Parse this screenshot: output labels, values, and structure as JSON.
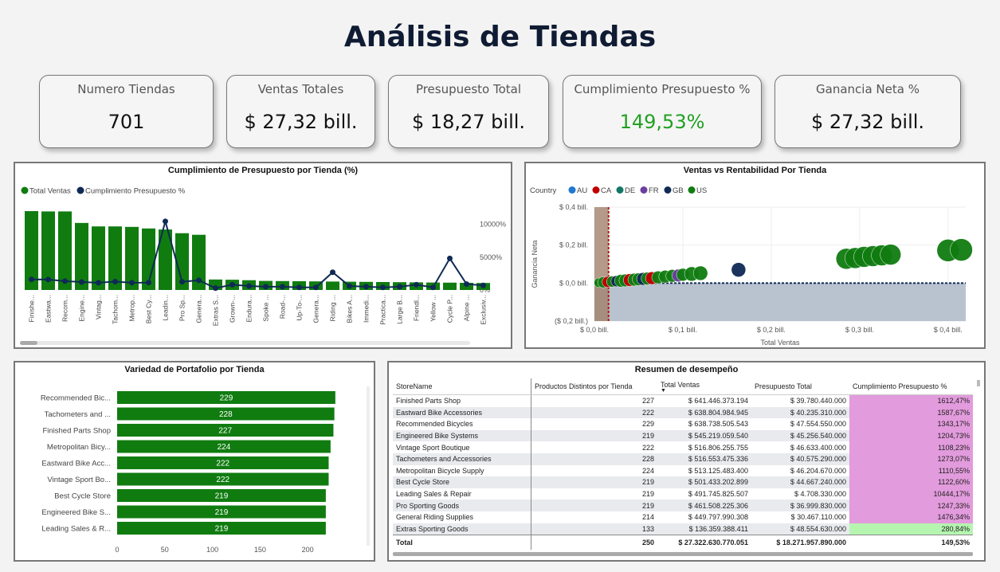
{
  "page": {
    "title": "Análisis de Tiendas"
  },
  "kpis": [
    {
      "label": "Numero Tiendas",
      "value": "701",
      "color": "#111111"
    },
    {
      "label": "Ventas Totales",
      "value": "$ 27,32 bill.",
      "color": "#111111"
    },
    {
      "label": "Presupuesto Total",
      "value": "$ 18,27 bill.",
      "color": "#111111"
    },
    {
      "label": "Cumplimiento Presupuesto %",
      "value": "149,53%",
      "color": "#22a022"
    },
    {
      "label": "Ganancia Neta %",
      "value": "$ 27,32 bill.",
      "color": "#111111"
    }
  ],
  "panels": {
    "combo": "Cumplimiento de Presupuesto por Tienda (%)",
    "scatter": "Ventas vs Rentabilidad Por Tienda",
    "hbar": "Variedad de Portafolio por Tienda",
    "table": "Resumen de desempeño"
  },
  "chart_data": [
    {
      "type": "bar",
      "title": "Cumplimiento de Presupuesto por Tienda (%)",
      "legend": [
        "Total Ventas",
        "Cumplimiento Presupuesto %"
      ],
      "legend_position": "top-left",
      "colors": {
        "bars": "#107c10",
        "line": "#0f2a55"
      },
      "categories": [
        "Finishe...",
        "Eastwa...",
        "Recom...",
        "Engine...",
        "Vintag...",
        "Tachom...",
        "Metrop...",
        "Best Cy...",
        "Leadin...",
        "Pro Sp...",
        "Genera...",
        "Extras S...",
        "Grown-...",
        "Endura...",
        "Spoke ...",
        "Road-...",
        "Up-To-...",
        "Genera...",
        "Riding ...",
        "Bikes A...",
        "Immedi...",
        "Practica...",
        "Large B...",
        "Friendl...",
        "Yellow ...",
        "Cycle P...",
        "Alpine ...",
        "Exclusiv..."
      ],
      "series": [
        {
          "name": "Total Ventas",
          "values": [
            100,
            99.6,
            99.6,
            85,
            80.6,
            80.6,
            80,
            78,
            76.7,
            72,
            70,
            13.3,
            13,
            12.4,
            11.5,
            11.3,
            11.1,
            10.9,
            10.7,
            10.5,
            10.3,
            10.1,
            9.9,
            9.7,
            9.5,
            9.3,
            9.1,
            8.9
          ]
        },
        {
          "name": "Cumplimiento Presupuesto %",
          "values": [
            1612,
            1588,
            1343,
            1205,
            1108,
            1273,
            1111,
            1123,
            10444,
            1247,
            1476,
            281,
            800,
            600,
            500,
            500,
            400,
            400,
            2700,
            600,
            500,
            400,
            500,
            800,
            400,
            4800,
            900,
            700
          ]
        }
      ],
      "y2_ticks": [
        "10000%",
        "5000%",
        "0%"
      ],
      "y2lim": [
        0,
        12000
      ]
    },
    {
      "type": "scatter",
      "title": "Ventas vs Rentabilidad Por Tienda",
      "legend_title": "Country",
      "legend": [
        {
          "name": "AU",
          "color": "#1f78d1"
        },
        {
          "name": "CA",
          "color": "#c00000"
        },
        {
          "name": "DE",
          "color": "#117865"
        },
        {
          "name": "FR",
          "color": "#6b3fa0"
        },
        {
          "name": "GB",
          "color": "#0f2a55"
        },
        {
          "name": "US",
          "color": "#107c10"
        }
      ],
      "legend_position": "top-left",
      "xlabel": "Total Ventas",
      "ylabel": "Ganancia Neta",
      "x_ticks": [
        "$ 0,0 bill.",
        "$ 0,1 bill.",
        "$ 0,2 bill.",
        "$ 0,3 bill.",
        "$ 0,4 bill."
      ],
      "y_ticks": [
        "$ 0,4 bill.",
        "$ 0,2 bill.",
        "$ 0,0 bill.",
        "($ 0,2 bill.)"
      ],
      "xlim": [
        0,
        0.42
      ],
      "ylim": [
        -0.2,
        0.4
      ],
      "points": [
        {
          "x": 0.005,
          "y": 0.002,
          "c": "US",
          "r": 6
        },
        {
          "x": 0.01,
          "y": 0.004,
          "c": "US",
          "r": 7
        },
        {
          "x": 0.015,
          "y": 0.006,
          "c": "CA",
          "r": 7
        },
        {
          "x": 0.02,
          "y": 0.008,
          "c": "US",
          "r": 7
        },
        {
          "x": 0.025,
          "y": 0.01,
          "c": "GB",
          "r": 7
        },
        {
          "x": 0.03,
          "y": 0.012,
          "c": "US",
          "r": 8
        },
        {
          "x": 0.035,
          "y": 0.014,
          "c": "US",
          "r": 8
        },
        {
          "x": 0.04,
          "y": 0.016,
          "c": "CA",
          "r": 8
        },
        {
          "x": 0.045,
          "y": 0.018,
          "c": "US",
          "r": 8
        },
        {
          "x": 0.05,
          "y": 0.02,
          "c": "US",
          "r": 8
        },
        {
          "x": 0.055,
          "y": 0.022,
          "c": "GB",
          "r": 8
        },
        {
          "x": 0.06,
          "y": 0.024,
          "c": "US",
          "r": 8
        },
        {
          "x": 0.065,
          "y": 0.026,
          "c": "CA",
          "r": 8
        },
        {
          "x": 0.072,
          "y": 0.03,
          "c": "US",
          "r": 8
        },
        {
          "x": 0.08,
          "y": 0.034,
          "c": "US",
          "r": 8
        },
        {
          "x": 0.088,
          "y": 0.038,
          "c": "US",
          "r": 8
        },
        {
          "x": 0.095,
          "y": 0.04,
          "c": "FR",
          "r": 8
        },
        {
          "x": 0.1,
          "y": 0.044,
          "c": "US",
          "r": 8
        },
        {
          "x": 0.11,
          "y": 0.048,
          "c": "US",
          "r": 9
        },
        {
          "x": 0.12,
          "y": 0.052,
          "c": "US",
          "r": 9
        },
        {
          "x": 0.163,
          "y": 0.07,
          "c": "GB",
          "r": 9
        },
        {
          "x": 0.285,
          "y": 0.128,
          "c": "US",
          "r": 13
        },
        {
          "x": 0.295,
          "y": 0.132,
          "c": "US",
          "r": 13
        },
        {
          "x": 0.305,
          "y": 0.138,
          "c": "US",
          "r": 13
        },
        {
          "x": 0.315,
          "y": 0.142,
          "c": "US",
          "r": 13
        },
        {
          "x": 0.325,
          "y": 0.146,
          "c": "US",
          "r": 13
        },
        {
          "x": 0.335,
          "y": 0.15,
          "c": "US",
          "r": 13
        },
        {
          "x": 0.4,
          "y": 0.172,
          "c": "US",
          "r": 14
        },
        {
          "x": 0.415,
          "y": 0.175,
          "c": "US",
          "r": 14
        }
      ]
    },
    {
      "type": "bar",
      "orientation": "horizontal",
      "title": "Variedad de Portafolio por Tienda",
      "categories": [
        "Recommended Bic...",
        "Tachometers and ...",
        "Finished Parts Shop",
        "Metropolitan Bicy...",
        "Eastward Bike Acc...",
        "Vintage Sport Bo...",
        "Best Cycle Store",
        "Engineered Bike S...",
        "Leading Sales & R..."
      ],
      "values": [
        229,
        228,
        227,
        224,
        222,
        222,
        219,
        219,
        219
      ],
      "x_ticks": [
        0,
        50,
        100,
        150,
        200
      ],
      "xlim": [
        0,
        240
      ],
      "color": "#107c10"
    }
  ],
  "table": {
    "headers": [
      "StoreName",
      "Productos Distintos por Tienda",
      "Total Ventas",
      "Presupuesto Total",
      "Cumplimiento Presupuesto %"
    ],
    "rows": [
      [
        "Finished Parts Shop",
        "227",
        "$ 641.446.373.194",
        "$ 39.780.440.000",
        "1612,47%"
      ],
      [
        "Eastward Bike Accessories",
        "222",
        "$ 638.804.984.945",
        "$ 40.235.310.000",
        "1587,67%"
      ],
      [
        "Recommended Bicycles",
        "229",
        "$ 638.738.505.543",
        "$ 47.554.550.000",
        "1343,17%"
      ],
      [
        "Engineered Bike Systems",
        "219",
        "$ 545.219.059.540",
        "$ 45.256.540.000",
        "1204,73%"
      ],
      [
        "Vintage Sport Boutique",
        "222",
        "$ 516.806.255.755",
        "$ 46.633.400.000",
        "1108,23%"
      ],
      [
        "Tachometers and Accessories",
        "228",
        "$ 516.553.475.336",
        "$ 40.575.290.000",
        "1273,07%"
      ],
      [
        "Metropolitan Bicycle Supply",
        "224",
        "$ 513.125.483.400",
        "$ 46.204.670.000",
        "1110,55%"
      ],
      [
        "Best Cycle Store",
        "219",
        "$ 501.433.202.899",
        "$ 44.667.240.000",
        "1122,60%"
      ],
      [
        "Leading Sales & Repair",
        "219",
        "$ 491.745.825.507",
        "$ 4.708.330.000",
        "10444,17%"
      ],
      [
        "Pro Sporting Goods",
        "219",
        "$ 461.508.225.306",
        "$ 36.999.830.000",
        "1247,33%"
      ],
      [
        "General Riding Supplies",
        "214",
        "$ 449.797.990.308",
        "$ 30.467.110.000",
        "1476,34%"
      ],
      [
        "Extras Sporting Goods",
        "133",
        "$ 136.359.388.411",
        "$ 48.554.630.000",
        "280,84%"
      ]
    ],
    "row_highlight": [
      "#e29bdc",
      "#e29bdc",
      "#e29bdc",
      "#e29bdc",
      "#e29bdc",
      "#e29bdc",
      "#e29bdc",
      "#e29bdc",
      "#e29bdc",
      "#e29bdc",
      "#e29bdc",
      "#b6f5b0"
    ],
    "total": [
      "Total",
      "250",
      "$ 27.322.630.770.051",
      "$ 18.271.957.890.000",
      "149,53%"
    ]
  }
}
